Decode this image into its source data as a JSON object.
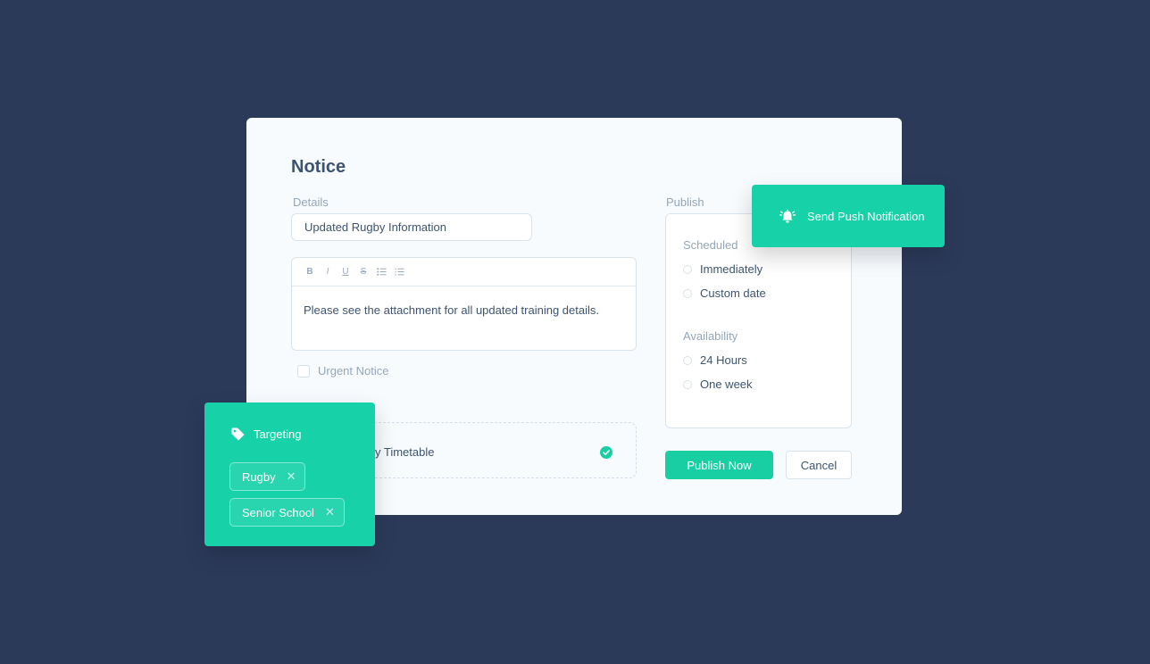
{
  "notice": {
    "title": "Notice",
    "details_label": "Details",
    "details_value": "Updated Rugby Information",
    "editor_toolbar": [
      "B",
      "I",
      "U",
      "S",
      "bulleted-list",
      "numbered-list"
    ],
    "editor_text": "Please see the attachment for all updated training details.",
    "urgent_label": "Urgent Notice",
    "attachment_text": "y Timetable"
  },
  "publish": {
    "label": "Publish",
    "scheduled_label": "Scheduled",
    "scheduled_options": [
      "Immediately",
      "Custom date"
    ],
    "availability_label": "Availability",
    "availability_options": [
      "24 Hours",
      "One week"
    ],
    "publish_button": "Publish Now",
    "cancel_button": "Cancel"
  },
  "push": {
    "label": "Send Push Notification",
    "icon": "alarm-bell-icon"
  },
  "targeting": {
    "label": "Targeting",
    "icon": "tag-icon",
    "tags": [
      "Rugby",
      "Senior School"
    ]
  },
  "colors": {
    "background": "#2c3a5a",
    "accent": "#17cfa3",
    "card": "#f7fbfe"
  }
}
